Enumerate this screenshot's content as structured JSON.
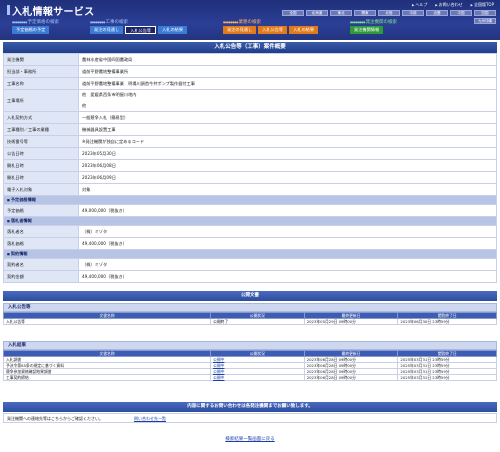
{
  "header": {
    "title": "入札情報サービス",
    "links": [
      "ヘルプ",
      "お問い合わせ",
      "全国版TOP"
    ],
    "regions": [
      "全国",
      "北海道",
      "東北",
      "関東",
      "北陸",
      "中部",
      "近畿",
      "中国",
      "四国",
      "九州沖縄"
    ]
  },
  "nav": {
    "groups": [
      {
        "label": "予定価格の検索",
        "color": "#3b7bd6",
        "tabs": [
          {
            "label": "予定価格の予定",
            "bg": "#3b7bd6"
          }
        ]
      },
      {
        "label": "工事の検索",
        "color": "#3b7bd6",
        "tabs": [
          {
            "label": "発注の見通し",
            "bg": "#3b7bd6"
          },
          {
            "label": "入札公告等",
            "bg": "#1a2466"
          },
          {
            "label": "入札の結果",
            "bg": "#3b7bd6"
          }
        ]
      },
      {
        "label": "業務の検索",
        "color": "#e07a1a",
        "tabs": [
          {
            "label": "発注の見通し",
            "bg": "#e07a1a"
          },
          {
            "label": "入札公告等",
            "bg": "#e07a1a"
          },
          {
            "label": "入札の結果",
            "bg": "#e07a1a"
          }
        ]
      },
      {
        "label": "発注機関の検索",
        "color": "#2f9a3a",
        "tabs": [
          {
            "label": "発注機関情報",
            "bg": "#2f9a3a"
          }
        ]
      }
    ]
  },
  "page_title": "入札公告等（工事）案件概要",
  "info_rows": [
    {
      "type": "row",
      "label": "発注機関",
      "value": "農林水産省中国四国農政局"
    },
    {
      "type": "row",
      "label": "担当部・事務所",
      "value": "道前平野農地整備事業所"
    },
    {
      "type": "row",
      "label": "工事名称",
      "value": "道前平野農地整備事業　明場川頭首今井ポンプ製作据付工事"
    },
    {
      "type": "row2",
      "label": "工事場所",
      "value": "他　愛媛県西条市明屋川地内",
      "value2": "他"
    },
    {
      "type": "row",
      "label": "入札契約方式",
      "value": "一般競争入札（簡易型）"
    },
    {
      "type": "row",
      "label": "工事種別／工事の業種",
      "value": "機械器具設置工事"
    },
    {
      "type": "row",
      "label": "技術番号等",
      "value": "※発注機関が独自に定めるコード"
    },
    {
      "type": "row",
      "label": "公告日時",
      "value": "2023年05月30日"
    },
    {
      "type": "row",
      "label": "開札日時",
      "value": "2023年06月08日"
    },
    {
      "type": "row",
      "label": "開札日時",
      "value": "2023年06月09日"
    },
    {
      "type": "row",
      "label": "電子入札対象",
      "value": "対象"
    },
    {
      "type": "sec",
      "label": "予定価格情報"
    },
    {
      "type": "row",
      "label": "予定価格",
      "value": "49,000,000（税抜き）"
    },
    {
      "type": "sec",
      "label": "落札者情報"
    },
    {
      "type": "row",
      "label": "落札者名",
      "value": "（株）ミゾタ"
    },
    {
      "type": "row",
      "label": "落札価格",
      "value": "49,400,000（税抜き）"
    },
    {
      "type": "sec",
      "label": "契約情報"
    },
    {
      "type": "row",
      "label": "契約者名",
      "value": "（株）ミゾタ"
    },
    {
      "type": "row",
      "label": "契約金額",
      "value": "49,400,000（税抜き）"
    }
  ],
  "public_docs": {
    "title": "公開文書",
    "sections": [
      {
        "name": "入札公告等",
        "headers": [
          "文書名称",
          "公開状況",
          "最終更新日",
          "閲覧終了日"
        ],
        "rows": [
          [
            "入札公告等",
            "公開終了",
            "2023年05月29日 09時00分",
            "2023年06月30日 23時59分"
          ]
        ]
      },
      {
        "name": "入札結果",
        "headers": [
          "文書名称",
          "公開状況",
          "最終更新日",
          "閲覧終了日"
        ],
        "rows": [
          [
            "入札調書",
            "公開中",
            "2023年06月28日 09時00分",
            "2025年03月31日 23時59分"
          ],
          [
            "予決令第85条の規定に基づく資料",
            "公開中",
            "2023年06月28日 09時00分",
            "2025年03月31日 23時59分"
          ],
          [
            "競争参加資格確認結果調書",
            "公開中",
            "2023年06月28日 09時00分",
            "2025年03月31日 23時59分"
          ],
          [
            "工事契約締結",
            "公開中",
            "2023年06月28日 09時00分",
            "2025年03月31日 23時59分"
          ]
        ]
      }
    ]
  },
  "contact": {
    "title": "内容に関するお問い合わせは各発注機関までお願い致します。",
    "left": "発注機関への連絡先等はこちらからご確認ください。",
    "link": "問い合わせ先一覧"
  },
  "back_link": "検索結果一覧画面に戻る"
}
